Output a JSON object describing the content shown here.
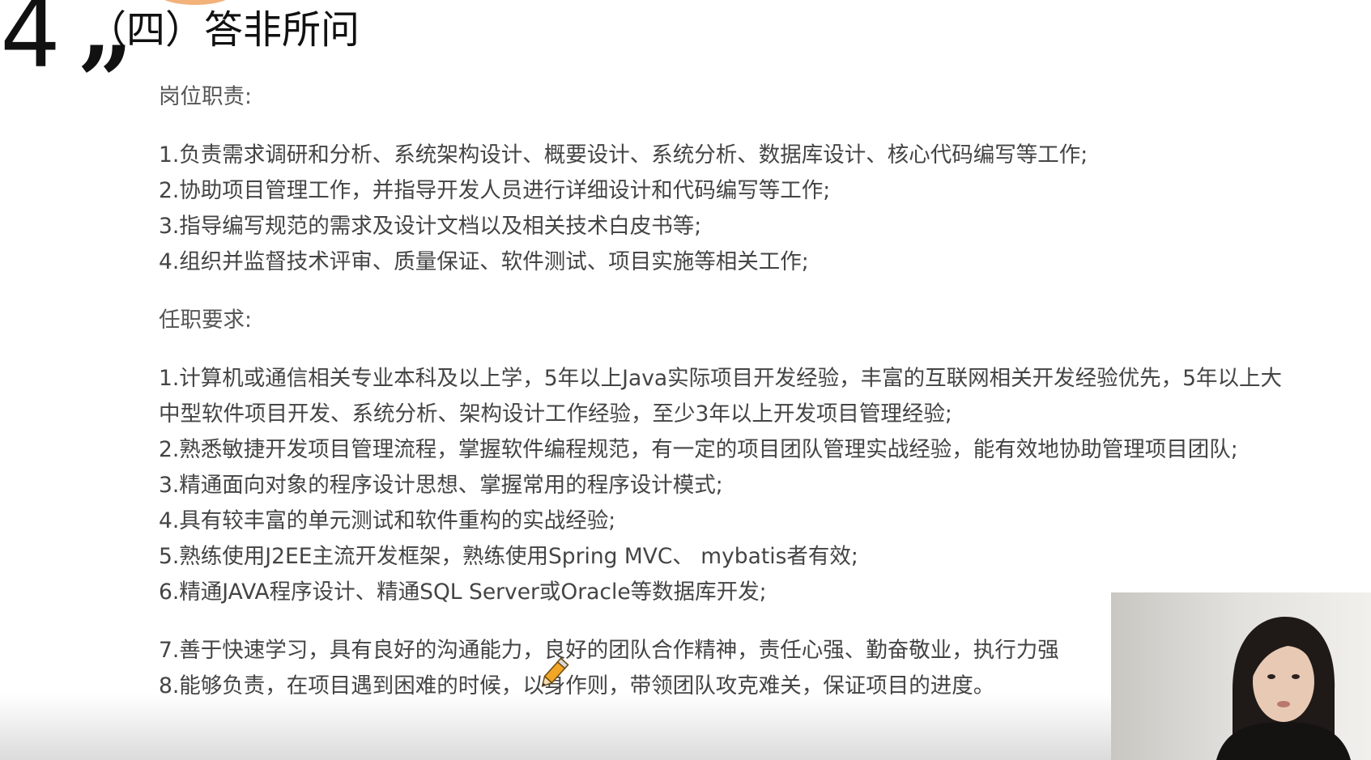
{
  "slide": {
    "number": "4",
    "quote_mark": "”",
    "heading": "（四）答非所问"
  },
  "responsibilities": {
    "title": "岗位职责:",
    "items": [
      "1.负责需求调研和分析、系统架构设计、概要设计、系统分析、数据库设计、核心代码编写等工作;",
      "2.协助项目管理工作，并指导开发人员进行详细设计和代码编写等工作;",
      "3.指导编写规范的需求及设计文档以及相关技术白皮书等;",
      "4.组织并监督技术评审、质量保证、软件测试、项目实施等相关工作;"
    ]
  },
  "requirements": {
    "title": "任职要求:",
    "items": [
      "1.计算机或通信相关专业本科及以上学，5年以上Java实际项目开发经验，丰富的互联网相关开发经验优先，5年以上大中型软件项目开发、系统分析、架构设计工作经验，至少3年以上开发项目管理经验;",
      "2.熟悉敏捷开发项目管理流程，掌握软件编程规范，有一定的项目团队管理实战经验，能有效地协助管理项目团队;",
      "3.精通面向对象的程序设计思想、掌握常用的程序设计模式;",
      "4.具有较丰富的单元测试和软件重构的实战经验;",
      "5.熟练使用J2EE主流开发框架，熟练使用Spring MVC、 mybatis者有效;",
      "6.精通JAVA程序设计、精通SQL Server或Oracle等数据库开发;",
      "7.善于快速学习，具有良好的沟通能力，良好的团队合作精神，责任心强、勤奋敬业，执行力强",
      "8.能够负责，在项目遇到困难的时候，以身作则，带领团队攻克难关，保证项目的进度。"
    ]
  },
  "overlays": {
    "cursor_icon": "pencil-icon",
    "webcam_icon": "presenter-video"
  },
  "colors": {
    "heading": "#111111",
    "body_text": "#444444",
    "accent_orange": "#f2b27a",
    "pencil_yellow": "#f0a626"
  }
}
